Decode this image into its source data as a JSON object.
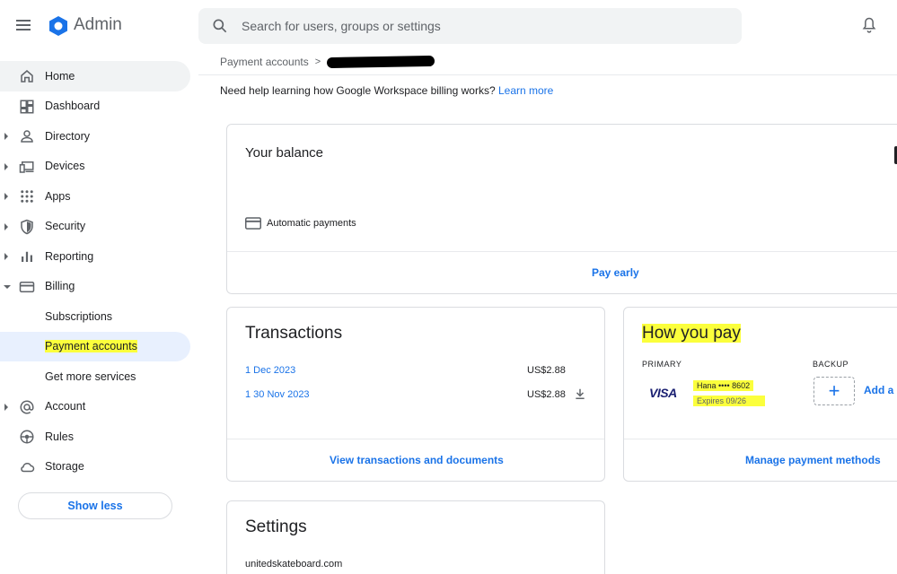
{
  "header": {
    "app_name": "Admin",
    "search_placeholder": "Search for users, groups or settings"
  },
  "sidebar": {
    "items": [
      {
        "label": "Home",
        "icon": "home-icon"
      },
      {
        "label": "Dashboard",
        "icon": "dashboard-icon"
      },
      {
        "label": "Directory",
        "icon": "person-icon"
      },
      {
        "label": "Devices",
        "icon": "devices-icon"
      },
      {
        "label": "Apps",
        "icon": "apps-grid-icon"
      },
      {
        "label": "Security",
        "icon": "shield-icon"
      },
      {
        "label": "Reporting",
        "icon": "bar-chart-icon"
      },
      {
        "label": "Billing",
        "icon": "credit-card-icon"
      },
      {
        "label": "Subscriptions"
      },
      {
        "label": "Payment accounts"
      },
      {
        "label": "Get more services"
      },
      {
        "label": "Account",
        "icon": "at-sign-icon"
      },
      {
        "label": "Rules",
        "icon": "rules-icon"
      },
      {
        "label": "Storage",
        "icon": "cloud-icon"
      }
    ],
    "show_less": "Show less"
  },
  "breadcrumb": {
    "parent": "Payment accounts",
    "separator": ">"
  },
  "help": {
    "text": "Need help learning how Google Workspace billing works?",
    "link": "Learn more"
  },
  "balance": {
    "title": "Your balance",
    "auto_payments": "Automatic payments",
    "pay_early": "Pay early"
  },
  "transactions": {
    "title": "Transactions",
    "rows": [
      {
        "date": "1 Dec 2023",
        "amount": "US$2.88",
        "download": false
      },
      {
        "date": "1  30 Nov 2023",
        "amount": "US$2.88",
        "download": true
      }
    ],
    "footer_link": "View transactions and documents"
  },
  "how_you_pay": {
    "title": "How you pay",
    "primary_label": "PRIMARY",
    "backup_label": "BACKUP",
    "card_brand": "VISA",
    "card_holder_number": "Hana •••• 8602",
    "expires": "Expires 09/26",
    "add_label": "Add a",
    "add_symbol": "+",
    "footer_link": "Manage payment methods"
  },
  "settings": {
    "title": "Settings",
    "domain": "unitedskateboard.com"
  },
  "colors": {
    "accent": "#1a73e8",
    "highlight": "#fbff3c",
    "active_nav": "#e8f0fe"
  }
}
